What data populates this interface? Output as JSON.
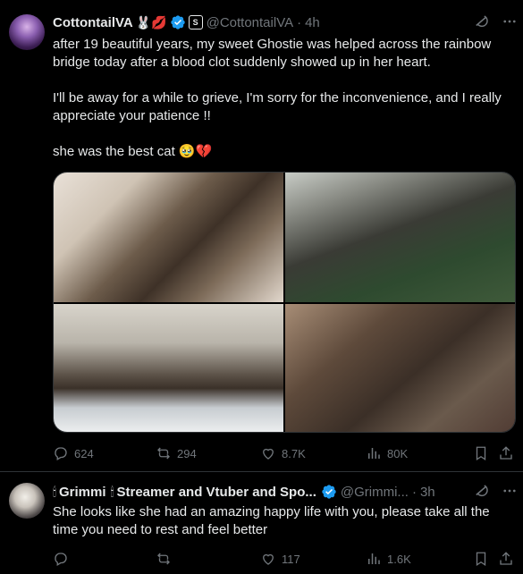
{
  "post1": {
    "name": "CottontailVA",
    "name_emojis": "🐰💋",
    "handle": "@CottontailVA",
    "separator": "·",
    "time": "4h",
    "paragraphs": [
      "after 19 beautiful years, my sweet Ghostie was helped across the rainbow bridge today after a blood clot suddenly showed up in her heart.",
      "I'll be away for a while to grieve, I'm sorry for the inconvenience, and I really appreciate your patience !!",
      "she was the best cat 🥹💔"
    ],
    "stats": {
      "replies": "624",
      "reposts": "294",
      "likes": "8.7K",
      "views": "80K"
    }
  },
  "post2": {
    "name_prefix": "🕯",
    "name": "Grimmi",
    "name_mid": "🕯",
    "name_suffix": "Streamer and Vtuber and Spo...",
    "handle": "@Grimmi...",
    "separator": "·",
    "time": "3h",
    "text": "She looks like she had an amazing happy life with you, please take all the time you need to rest and feel better",
    "stats": {
      "replies": "",
      "reposts": "",
      "likes": "117",
      "views": "1.6K"
    }
  },
  "icons": [
    "grok-icon",
    "more-icon",
    "reply-icon",
    "repost-icon",
    "like-icon",
    "views-icon",
    "bookmark-icon",
    "share-icon",
    "verified-icon"
  ],
  "colors": {
    "background": "#000000",
    "text": "#e7e9ea",
    "muted": "#71767b",
    "verified": "#1d9bf0",
    "border": "#2f3336"
  }
}
